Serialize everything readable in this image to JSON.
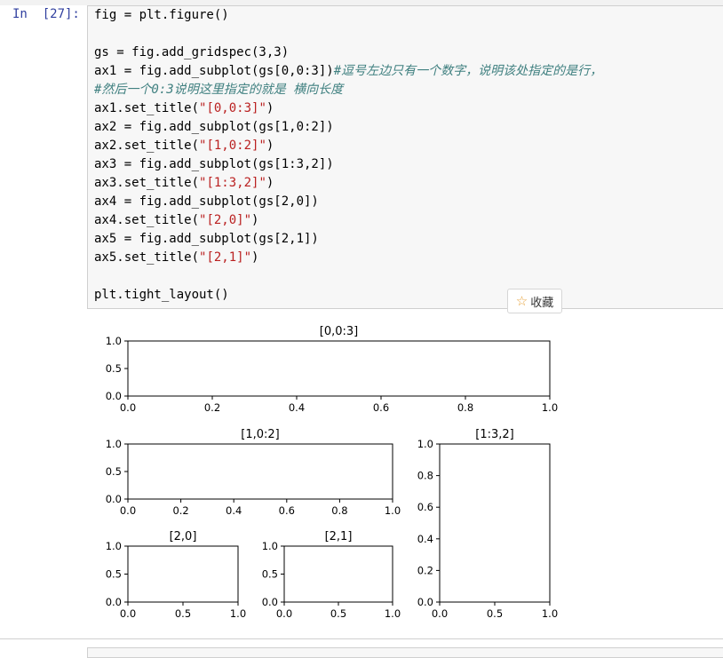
{
  "cell": {
    "prompt": "In  [27]:",
    "code_lines": [
      [
        {
          "t": "fig = plt.figure()",
          "c": ""
        }
      ],
      [
        {
          "t": "",
          "c": ""
        }
      ],
      [
        {
          "t": "gs = fig.add_gridspec(3,3)",
          "c": ""
        }
      ],
      [
        {
          "t": "ax1 = fig.add_subplot(gs[0,0:3])",
          "c": ""
        },
        {
          "t": "#逗号左边只有一个数字，说明该处指定的是行，",
          "c": "cmt"
        }
      ],
      [
        {
          "t": "#然后一个0:3说明这里指定的就是 横向长度",
          "c": "cmt"
        }
      ],
      [
        {
          "t": "ax1.set_title(",
          "c": ""
        },
        {
          "t": "\"[0,0:3]\"",
          "c": "str"
        },
        {
          "t": ")",
          "c": ""
        }
      ],
      [
        {
          "t": "ax2 = fig.add_subplot(gs[1,0:2])",
          "c": ""
        }
      ],
      [
        {
          "t": "ax2.set_title(",
          "c": ""
        },
        {
          "t": "\"[1,0:2]\"",
          "c": "str"
        },
        {
          "t": ")",
          "c": ""
        }
      ],
      [
        {
          "t": "ax3 = fig.add_subplot(gs[1:3,2])",
          "c": ""
        }
      ],
      [
        {
          "t": "ax3.set_title(",
          "c": ""
        },
        {
          "t": "\"[1:3,2]\"",
          "c": "str"
        },
        {
          "t": ")",
          "c": ""
        }
      ],
      [
        {
          "t": "ax4 = fig.add_subplot(gs[2,0])",
          "c": ""
        }
      ],
      [
        {
          "t": "ax4.set_title(",
          "c": ""
        },
        {
          "t": "\"[2,0]\"",
          "c": "str"
        },
        {
          "t": ")",
          "c": ""
        }
      ],
      [
        {
          "t": "ax5 = fig.add_subplot(gs[2,1])",
          "c": ""
        }
      ],
      [
        {
          "t": "ax5.set_title(",
          "c": ""
        },
        {
          "t": "\"[2,1]\"",
          "c": "str"
        },
        {
          "t": ")",
          "c": ""
        }
      ],
      [
        {
          "t": "",
          "c": ""
        }
      ],
      [
        {
          "t": "plt.tight_layout()",
          "c": ""
        }
      ]
    ]
  },
  "toolbar": {
    "favorite_label": "收藏",
    "favorite_icon": "star-outline-icon"
  },
  "colors": {
    "prompt": "#303f9f",
    "string": "#ba2121",
    "comment": "#408080",
    "star": "#e6a23c"
  },
  "chart_data": [
    {
      "type": "line",
      "title": "[0,0:3]",
      "series": [],
      "xlim": [
        0,
        1
      ],
      "ylim": [
        0,
        1
      ],
      "xticks": [
        "0.0",
        "0.2",
        "0.4",
        "0.6",
        "0.8",
        "1.0"
      ],
      "yticks": [
        "0.0",
        "0.5",
        "1.0"
      ]
    },
    {
      "type": "line",
      "title": "[1,0:2]",
      "series": [],
      "xlim": [
        0,
        1
      ],
      "ylim": [
        0,
        1
      ],
      "xticks": [
        "0.0",
        "0.2",
        "0.4",
        "0.6",
        "0.8",
        "1.0"
      ],
      "yticks": [
        "0.0",
        "0.5",
        "1.0"
      ]
    },
    {
      "type": "line",
      "title": "[1:3,2]",
      "series": [],
      "xlim": [
        0,
        1
      ],
      "ylim": [
        0,
        1
      ],
      "xticks": [
        "0.0",
        "0.5",
        "1.0"
      ],
      "yticks": [
        "0.0",
        "0.2",
        "0.4",
        "0.6",
        "0.8",
        "1.0"
      ]
    },
    {
      "type": "line",
      "title": "[2,0]",
      "series": [],
      "xlim": [
        0,
        1
      ],
      "ylim": [
        0,
        1
      ],
      "xticks": [
        "0.0",
        "0.5",
        "1.0"
      ],
      "yticks": [
        "0.0",
        "0.5",
        "1.0"
      ]
    },
    {
      "type": "line",
      "title": "[2,1]",
      "series": [],
      "xlim": [
        0,
        1
      ],
      "ylim": [
        0,
        1
      ],
      "xticks": [
        "0.0",
        "0.5",
        "1.0"
      ],
      "yticks": [
        "0.0",
        "0.5",
        "1.0"
      ]
    }
  ]
}
